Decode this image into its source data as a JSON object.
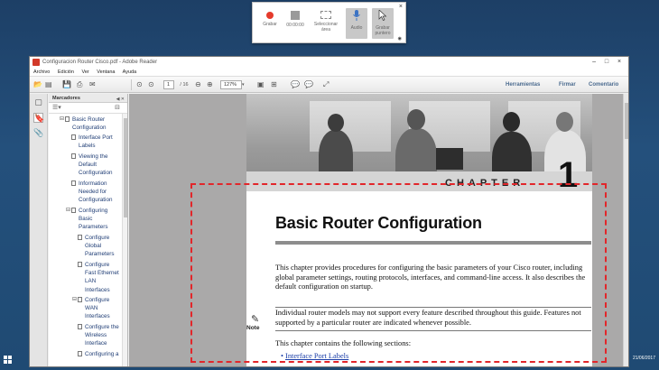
{
  "recorder": {
    "items": [
      {
        "label": "Grabar",
        "icon": "record-icon"
      },
      {
        "label": "00:00:00",
        "icon": "stop-icon"
      },
      {
        "label": "Seleccionar área",
        "icon": "select-area-icon"
      },
      {
        "label": "Audio",
        "icon": "microphone-icon"
      },
      {
        "label": "Grabar puntero",
        "icon": "pointer-icon"
      }
    ],
    "close": "×"
  },
  "window": {
    "title": "Configuracion Router Cisco.pdf - Adobe Reader",
    "menu": [
      "Archivo",
      "Edición",
      "Ver",
      "Ventana",
      "Ayuda"
    ],
    "toolbar": {
      "page_current": "1",
      "page_total": "/ 16",
      "zoom": "127%",
      "tools_label": "Herramientas",
      "sign_label": "Firmar",
      "comment_label": "Comentario"
    }
  },
  "bookmarks": {
    "title": "Marcadores",
    "items": [
      {
        "label": "Basic Router Configuration",
        "lines": [
          "Basic Router",
          "Configuration"
        ]
      },
      {
        "label": "Interface Port Labels",
        "lines": [
          "Interface Port",
          "Labels"
        ]
      },
      {
        "label": "Viewing the Default Configuration",
        "lines": [
          "Viewing the",
          "Default",
          "Configuration"
        ]
      },
      {
        "label": "Information Needed for Configuration",
        "lines": [
          "Information",
          "Needed for",
          "Configuration"
        ]
      },
      {
        "label": "Configuring Basic Parameters",
        "lines": [
          "Configuring",
          "Basic",
          "Parameters"
        ]
      },
      {
        "label": "Configure Global Parameters",
        "lines": [
          "Configure",
          "Global",
          "Parameters"
        ]
      },
      {
        "label": "Configure Fast Ethernet LAN Interfaces",
        "lines": [
          "Configure",
          "Fast Ethernet",
          "LAN",
          "Interfaces"
        ]
      },
      {
        "label": "Configure WAN Interfaces",
        "lines": [
          "Configure",
          "WAN",
          "Interfaces"
        ]
      },
      {
        "label": "Configure the Wireless Interface",
        "lines": [
          "Configure the",
          "Wireless",
          "Interface"
        ]
      },
      {
        "label": "Configuring a",
        "lines": [
          "Configuring a"
        ]
      }
    ]
  },
  "document": {
    "chapter_word": "CHAPTER",
    "chapter_number": "1",
    "title": "Basic Router Configuration",
    "intro": "This chapter provides procedures for configuring the basic parameters of your Cisco router, including global parameter settings, routing protocols, interfaces, and command-line access. It also describes the default configuration on startup.",
    "note_label": "Note",
    "note_text": "Individual router models may not support every feature described throughout this guide. Features not supported by a particular router are indicated whenever possible.",
    "sections_intro": "This chapter contains the following sections:",
    "bullet_1": "Interface Port Labels"
  },
  "taskbar": {
    "date": "21/06/2017"
  },
  "colors": {
    "selection": "#e2262a",
    "desktop": "#20456b",
    "link": "#1b3ea8"
  }
}
